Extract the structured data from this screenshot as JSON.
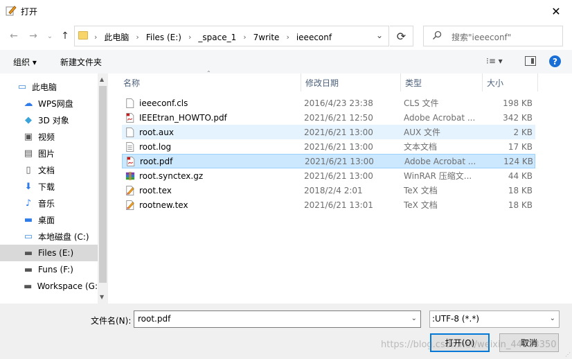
{
  "window": {
    "title": "打开",
    "close": "✕"
  },
  "nav": {
    "back": "←",
    "forward": "→",
    "recent": "⌄",
    "up": "↑",
    "breadcrumbs": [
      "此电脑",
      "Files (E:)",
      "_space_1",
      "7write",
      "ieeeconf"
    ],
    "separator": "›",
    "refresh": "⟳",
    "search_placeholder": "搜索\"ieeeconf\""
  },
  "toolbar": {
    "organize": "组织 ▾",
    "new_folder": "新建文件夹",
    "view": "⁝≡ ▾",
    "help": "?"
  },
  "sidebar": {
    "items": [
      {
        "label": "此电脑",
        "icon": "pc-icon",
        "glyph": "▭",
        "color": "#3c8be0",
        "indent": 1,
        "selected": false
      },
      {
        "label": "WPS网盘",
        "icon": "cloud-icon",
        "glyph": "☁",
        "color": "#2f7be8",
        "indent": 2,
        "selected": false
      },
      {
        "label": "3D 对象",
        "icon": "cube-icon",
        "glyph": "◆",
        "color": "#3aa3d9",
        "indent": 2,
        "selected": false
      },
      {
        "label": "视频",
        "icon": "video-icon",
        "glyph": "▣",
        "color": "#555555",
        "indent": 2,
        "selected": false
      },
      {
        "label": "图片",
        "icon": "picture-icon",
        "glyph": "▤",
        "color": "#555555",
        "indent": 2,
        "selected": false
      },
      {
        "label": "文档",
        "icon": "document-icon",
        "glyph": "▯",
        "color": "#555555",
        "indent": 2,
        "selected": false
      },
      {
        "label": "下载",
        "icon": "download-icon",
        "glyph": "⬇",
        "color": "#2f7be8",
        "indent": 2,
        "selected": false
      },
      {
        "label": "音乐",
        "icon": "music-icon",
        "glyph": "♪",
        "color": "#2f7be8",
        "indent": 2,
        "selected": false
      },
      {
        "label": "桌面",
        "icon": "desktop-icon",
        "glyph": "▬",
        "color": "#2f7be8",
        "indent": 2,
        "selected": false
      },
      {
        "label": "本地磁盘 (C:)",
        "icon": "drive-c-icon",
        "glyph": "▭",
        "color": "#3c8be0",
        "indent": 2,
        "selected": false
      },
      {
        "label": "Files (E:)",
        "icon": "drive-e-icon",
        "glyph": "▬",
        "color": "#555555",
        "indent": 2,
        "selected": true
      },
      {
        "label": "Funs (F:)",
        "icon": "drive-f-icon",
        "glyph": "▬",
        "color": "#555555",
        "indent": 2,
        "selected": false
      },
      {
        "label": "Workspace (G:",
        "icon": "drive-g-icon",
        "glyph": "▬",
        "color": "#555555",
        "indent": 2,
        "selected": false
      }
    ]
  },
  "columns": {
    "name": "名称",
    "date": "修改日期",
    "type": "类型",
    "size": "大小"
  },
  "files": [
    {
      "name": "ieeeconf.cls",
      "date": "2016/4/23 23:38",
      "type": "CLS 文件",
      "size": "198 KB",
      "icon": "text-file-icon",
      "state": ""
    },
    {
      "name": "IEEEtran_HOWTO.pdf",
      "date": "2021/6/21 12:50",
      "type": "Adobe Acrobat ...",
      "size": "342 KB",
      "icon": "pdf-file-icon",
      "state": ""
    },
    {
      "name": "root.aux",
      "date": "2021/6/21 13:00",
      "type": "AUX 文件",
      "size": "2 KB",
      "icon": "text-file-icon",
      "state": "hover"
    },
    {
      "name": "root.log",
      "date": "2021/6/21 13:00",
      "type": "文本文档",
      "size": "17 KB",
      "icon": "log-file-icon",
      "state": ""
    },
    {
      "name": "root.pdf",
      "date": "2021/6/21 13:00",
      "type": "Adobe Acrobat ...",
      "size": "124 KB",
      "icon": "pdf-file-icon",
      "state": "selected"
    },
    {
      "name": "root.synctex.gz",
      "date": "2021/6/21 13:00",
      "type": "WinRAR 压缩文...",
      "size": "44 KB",
      "icon": "archive-file-icon",
      "state": ""
    },
    {
      "name": "root.tex",
      "date": "2018/2/4 2:01",
      "type": "TeX 文档",
      "size": "18 KB",
      "icon": "tex-file-icon",
      "state": ""
    },
    {
      "name": "rootnew.tex",
      "date": "2021/6/21 13:01",
      "type": "TeX 文档",
      "size": "18 KB",
      "icon": "tex-file-icon",
      "state": ""
    }
  ],
  "footer": {
    "filename_label": "文件名(N):",
    "filename_value": "root.pdf",
    "filetype_value": ":UTF-8 (*.*)",
    "open_button": "打开(O)",
    "cancel_button": "取消",
    "watermark": "https://blog.csdn.net/weixin_44633350"
  }
}
